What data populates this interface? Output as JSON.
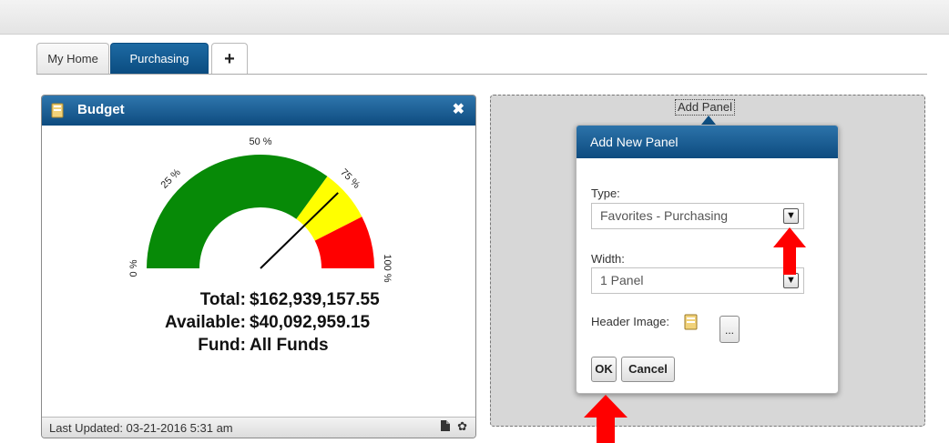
{
  "tabs": [
    {
      "label": "My Home"
    },
    {
      "label": "Purchasing"
    },
    {
      "label": "+"
    }
  ],
  "budget_panel": {
    "title": "Budget",
    "close_symbol": "✖",
    "gauge": {
      "ticks": [
        "0 %",
        "25 %",
        "50 %",
        "75 %",
        "100 %"
      ],
      "zones": [
        {
          "from": 0,
          "to": 0.7,
          "color": "#078a07"
        },
        {
          "from": 0.7,
          "to": 0.85,
          "color": "#ffff00"
        },
        {
          "from": 0.85,
          "to": 1.0,
          "color": "#ff0000"
        }
      ],
      "needle_value": 0.754
    },
    "total_label": "Total:",
    "total_value": "$162,939,157.55",
    "available_label": "Available:",
    "available_value": "$40,092,959.15",
    "fund_label": "Fund:",
    "fund_value": "All Funds",
    "last_updated": "Last Updated: 03-21-2016 5:31 am",
    "footer_icons": [
      "file-icon",
      "gear-icon"
    ]
  },
  "add_panel": {
    "link_label": "Add Panel",
    "dialog": {
      "title": "Add New Panel",
      "type_label": "Type:",
      "type_value": "Favorites - Purchasing",
      "width_label": "Width:",
      "width_value": "1 Panel",
      "header_image_label": "Header Image:",
      "browse_label": "...",
      "ok_label": "OK",
      "cancel_label": "Cancel"
    }
  },
  "colors": {
    "header_blue": "#0d4b7f",
    "arrow_red": "#ff0000"
  }
}
